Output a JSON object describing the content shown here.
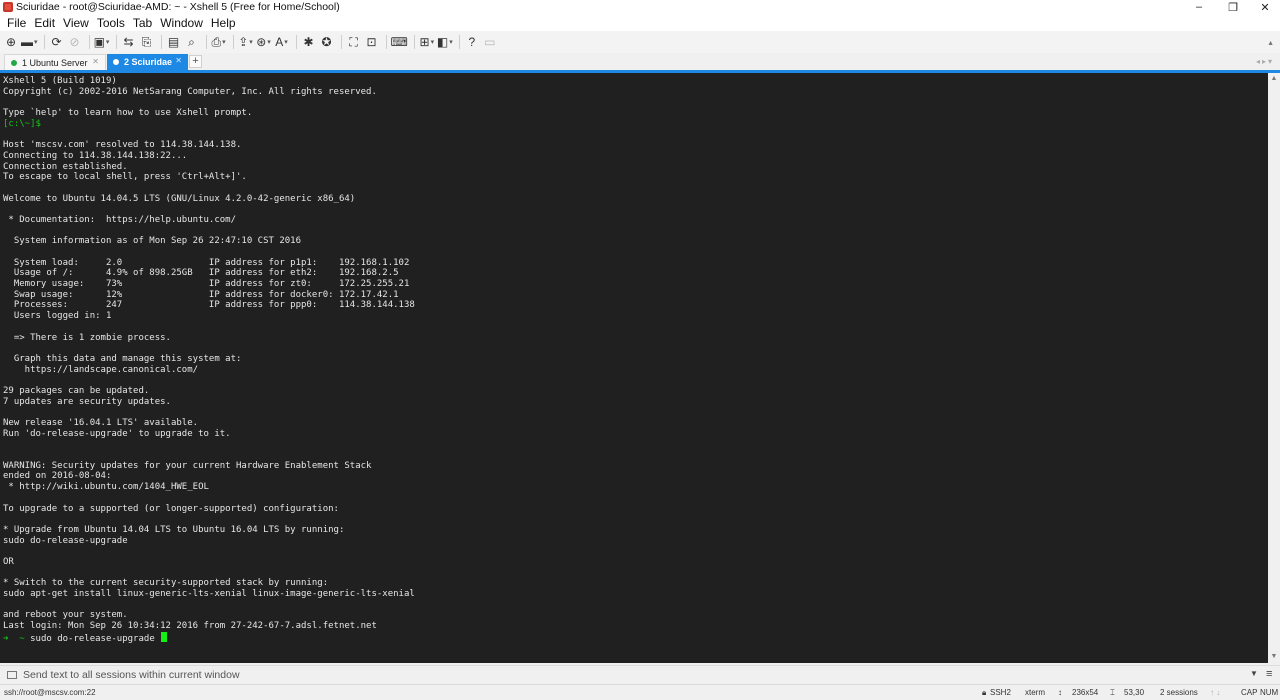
{
  "window": {
    "title": "Sciuridae - root@Sciuridae-AMD: ~ - Xshell 5 (Free for Home/School)",
    "controls": {
      "minimize": "–",
      "maximize": "❐",
      "close": "✕"
    }
  },
  "menu": [
    "File",
    "Edit",
    "View",
    "Tools",
    "Tab",
    "Window",
    "Help"
  ],
  "toolbar": {
    "icons": [
      {
        "name": "new-session-icon",
        "glyph": "⊕",
        "dropdown": false
      },
      {
        "name": "open-session-icon",
        "glyph": "▬",
        "dropdown": true
      },
      {
        "name": "reconnect-icon",
        "glyph": "⟳",
        "dropdown": false
      },
      {
        "name": "disconnect-icon",
        "glyph": "⊘",
        "dropdown": false
      },
      {
        "name": "new-tab-icon",
        "glyph": "▣",
        "dropdown": true
      },
      {
        "name": "transfer-icon",
        "glyph": "⇆",
        "dropdown": false
      },
      {
        "name": "copy-icon",
        "glyph": "⎘",
        "dropdown": false
      },
      {
        "name": "paste-icon",
        "glyph": "▤",
        "dropdown": false
      },
      {
        "name": "find-icon",
        "glyph": "⌕",
        "dropdown": false
      },
      {
        "name": "print-icon",
        "glyph": "⎙",
        "dropdown": true
      },
      {
        "name": "sftp-icon",
        "glyph": "⇪",
        "dropdown": true
      },
      {
        "name": "globe-icon",
        "glyph": "⊛",
        "dropdown": true
      },
      {
        "name": "font-icon",
        "glyph": "A",
        "dropdown": true
      },
      {
        "name": "script-icon",
        "glyph": "✱",
        "dropdown": false
      },
      {
        "name": "xftp-icon",
        "glyph": "✪",
        "dropdown": false
      },
      {
        "name": "fullscreen-icon",
        "glyph": "⛶",
        "dropdown": false
      },
      {
        "name": "lock-icon",
        "glyph": "⊡",
        "dropdown": false
      },
      {
        "name": "keyboard-icon",
        "glyph": "⌨",
        "dropdown": false
      },
      {
        "name": "add-icon",
        "glyph": "⊞",
        "dropdown": true
      },
      {
        "name": "layout-icon",
        "glyph": "◧",
        "dropdown": true
      },
      {
        "name": "help-icon",
        "glyph": "?",
        "dropdown": false
      },
      {
        "name": "comment-icon",
        "glyph": "▭",
        "dropdown": false
      }
    ]
  },
  "tabs": [
    {
      "label": "1 Ubuntu Server",
      "active": false,
      "status_color": "#22a845"
    },
    {
      "label": "2 Sciuridae",
      "active": true,
      "status_color": "#ffffff"
    }
  ],
  "tab_add_label": "+",
  "terminal": {
    "lines": [
      "Xshell 5 (Build 1019)",
      "Copyright (c) 2002-2016 NetSarang Computer, Inc. All rights reserved.",
      "",
      "Type `help' to learn how to use Xshell prompt.",
      "[c:\\~]$",
      "",
      "Host 'mscsv.com' resolved to 114.38.144.138.",
      "Connecting to 114.38.144.138:22...",
      "Connection established.",
      "To escape to local shell, press 'Ctrl+Alt+]'.",
      "",
      "Welcome to Ubuntu 14.04.5 LTS (GNU/Linux 4.2.0-42-generic x86_64)",
      "",
      " * Documentation:  https://help.ubuntu.com/",
      "",
      "  System information as of Mon Sep 26 22:47:10 CST 2016",
      "",
      "  System load:     2.0                IP address for p1p1:    192.168.1.102",
      "  Usage of /:      4.9% of 898.25GB   IP address for eth2:    192.168.2.5",
      "  Memory usage:    73%                IP address for zt0:     172.25.255.21",
      "  Swap usage:      12%                IP address for docker0: 172.17.42.1",
      "  Processes:       247                IP address for ppp0:    114.38.144.138",
      "  Users logged in: 1",
      "",
      "  => There is 1 zombie process.",
      "",
      "  Graph this data and manage this system at:",
      "    https://landscape.canonical.com/",
      "",
      "29 packages can be updated.",
      "7 updates are security updates.",
      "",
      "New release '16.04.1 LTS' available.",
      "Run 'do-release-upgrade' to upgrade to it.",
      "",
      "",
      "WARNING: Security updates for your current Hardware Enablement Stack",
      "ended on 2016-08-04:",
      " * http://wiki.ubuntu.com/1404_HWE_EOL",
      "",
      "To upgrade to a supported (or longer-supported) configuration:",
      "",
      "* Upgrade from Ubuntu 14.04 LTS to Ubuntu 16.04 LTS by running:",
      "sudo do-release-upgrade",
      "",
      "OR",
      "",
      "* Switch to the current security-supported stack by running:",
      "sudo apt-get install linux-generic-lts-xenial linux-image-generic-lts-xenial",
      "",
      "and reboot your system.",
      "Last login: Mon Sep 26 10:34:12 2016 from 27-242-67-7.adsl.fetnet.net"
    ],
    "green_line_index": 4,
    "prompt_arrow": "➜",
    "prompt_dir": "~",
    "command": "sudo do-release-upgrade"
  },
  "compose": {
    "placeholder": "Send text to all sessions within current window"
  },
  "status": {
    "address": "ssh://root@mscsv.com:22",
    "protocol": "SSH2",
    "terminal_type": "xterm",
    "size": "236x54",
    "cursor_pos": "53,30",
    "sessions": "2 sessions",
    "arrows": "↑ ↓",
    "cap": "CAP",
    "num": "NUM"
  },
  "colors": {
    "accent": "#1e88e5",
    "terminal_bg": "#202020",
    "terminal_fg": "#e6e6e6",
    "prompt_green": "#14c814"
  }
}
